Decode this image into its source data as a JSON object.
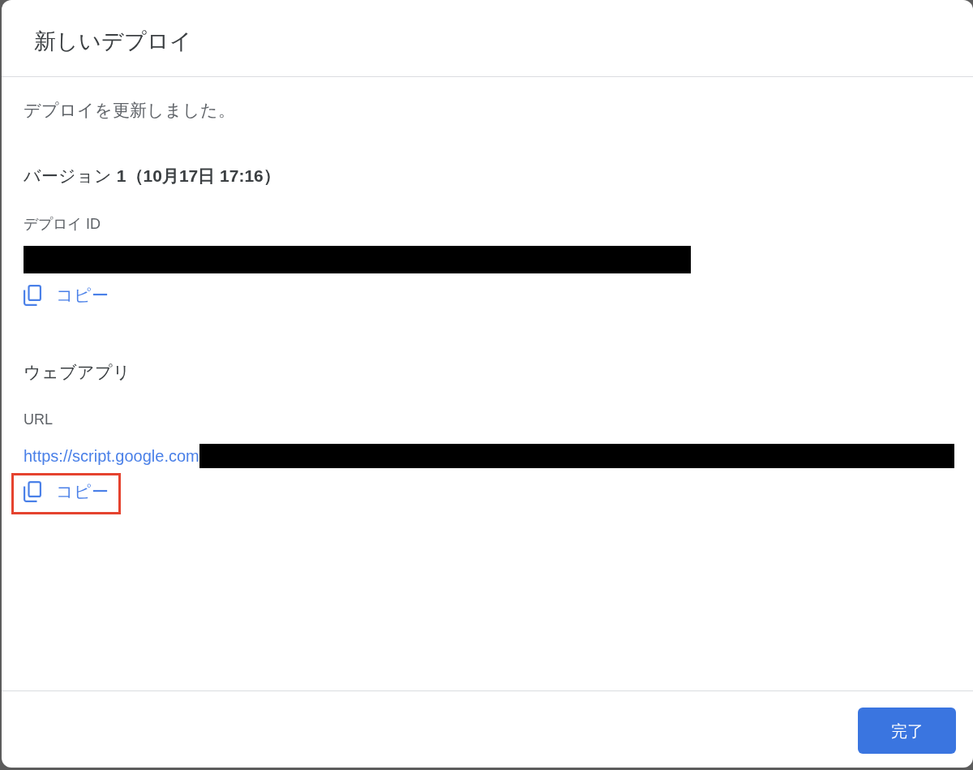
{
  "dialog": {
    "title": "新しいデプロイ"
  },
  "message": "デプロイを更新しました。",
  "version": "バージョン **1（10月17日 17:16）**",
  "deploy_id": {
    "label": "デプロイ ID",
    "copy": {
      "label": "コピー",
      "highlighted": false
    }
  },
  "web_app": {
    "heading": "ウェブアプリ",
    "url_label": "URL",
    "url": "https://script.google.com",
    "copy": {
      "label": "コピー",
      "highlighted": true
    }
  },
  "footer": {
    "done_button": {
      "label": "完了"
    }
  }
}
